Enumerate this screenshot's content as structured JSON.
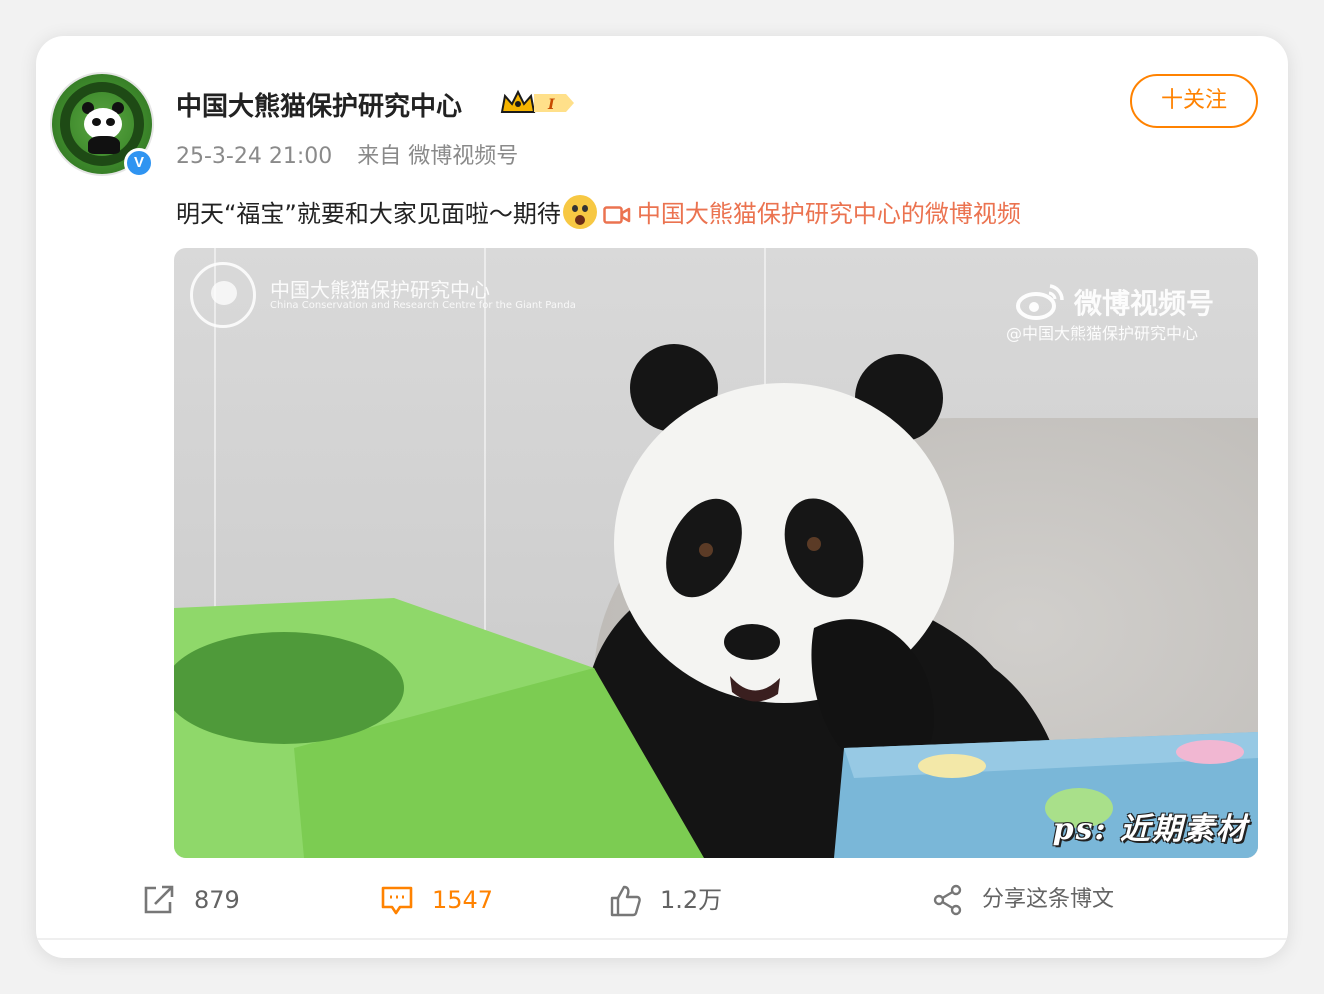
{
  "post": {
    "author": {
      "name": "中国大熊猫保护研究中心",
      "verified_mark": "V",
      "avatar_icon": "panda-logo"
    },
    "badge": {
      "level": "I",
      "color": "#f5b400"
    },
    "timestamp": "25-3-24 21:00",
    "source": "来自 微博视频号",
    "follow_label": "十关注",
    "text": "明天“福宝”就要和大家见面啦～期待",
    "emoji": "shock-face",
    "video_link": "中国大熊猫保护研究中心的微博视频",
    "media": {
      "watermark_title": "中国大熊猫保护研究中心",
      "watermark_subtitle": "China Conservation and Research Centre for the Giant Panda",
      "platform_title": "微博视频号",
      "platform_handle": "@中国大熊猫保护研究中心",
      "caption": "ps: 近期素材"
    },
    "actions": {
      "repost": "879",
      "comment": "1547",
      "like": "1.2万",
      "share": "分享这条博文"
    },
    "colors": {
      "accent": "#ff8200",
      "link": "#eb7350",
      "verified": "#2f94f1"
    }
  }
}
